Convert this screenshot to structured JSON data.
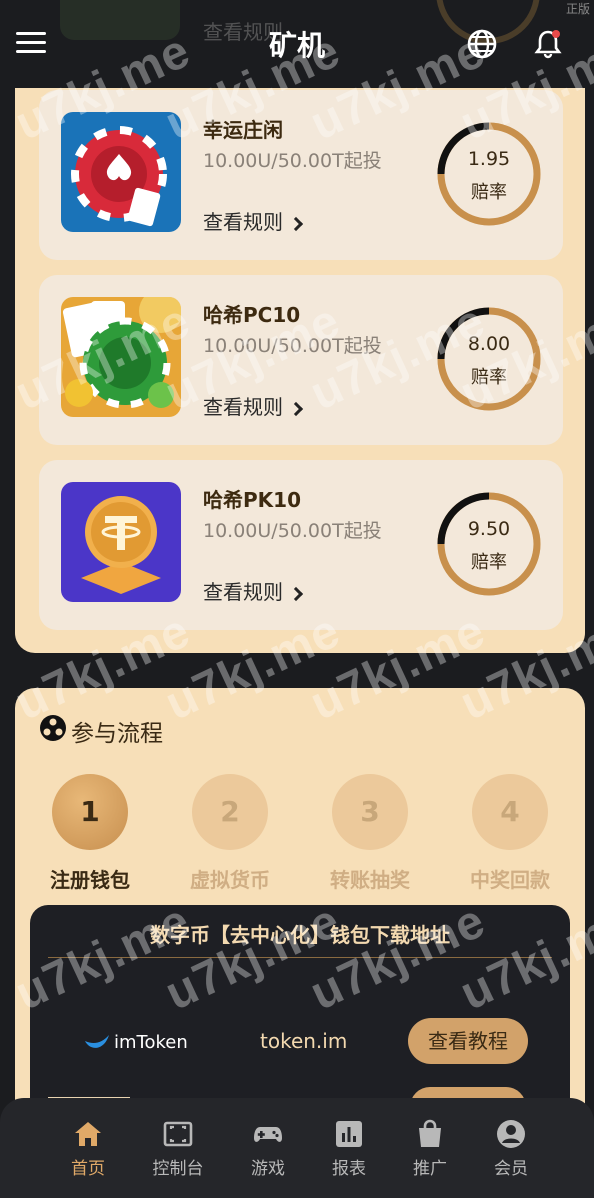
{
  "corner_label": "正版",
  "header": {
    "peek_text": "查看规则",
    "title": "矿机"
  },
  "games": [
    {
      "name": "幸运庄闲",
      "limit": "10.00U/50.00T起投",
      "rules_label": "查看规则",
      "odds": "1.95",
      "odds_label": "赔率",
      "odds_fraction": 0.9
    },
    {
      "name": "哈希PC10",
      "limit": "10.00U/50.00T起投",
      "rules_label": "查看规则",
      "odds": "8.00",
      "odds_label": "赔率",
      "odds_fraction": 0.9
    },
    {
      "name": "哈希PK10",
      "limit": "10.00U/50.00T起投",
      "rules_label": "查看规则",
      "odds": "9.50",
      "odds_label": "赔率",
      "odds_fraction": 0.9
    }
  ],
  "process": {
    "title": "参与流程",
    "steps": [
      {
        "num": "1",
        "label": "注册钱包",
        "active": true
      },
      {
        "num": "2",
        "label": "虚拟货币",
        "active": false
      },
      {
        "num": "3",
        "label": "转账抽奖",
        "active": false
      },
      {
        "num": "4",
        "label": "中奖回款",
        "active": false
      }
    ]
  },
  "wallet": {
    "title": "数字币【去中心化】钱包下载地址",
    "items": [
      {
        "logo_text": "imToken",
        "site": "token.im",
        "button": "查看教程"
      }
    ]
  },
  "bottom_nav": [
    {
      "label": "首页",
      "icon": "home-icon",
      "active": true
    },
    {
      "label": "控制台",
      "icon": "console-icon",
      "active": false
    },
    {
      "label": "游戏",
      "icon": "gamepad-icon",
      "active": false
    },
    {
      "label": "报表",
      "icon": "report-icon",
      "active": false
    },
    {
      "label": "推广",
      "icon": "bag-icon",
      "active": false
    },
    {
      "label": "会员",
      "icon": "user-icon",
      "active": false
    }
  ],
  "watermark": "u7kj.me",
  "colors": {
    "accent": "#d2a26a",
    "panel": "#f7dfb8",
    "card": "#f3e8da",
    "dark": "#1b1c1f"
  }
}
